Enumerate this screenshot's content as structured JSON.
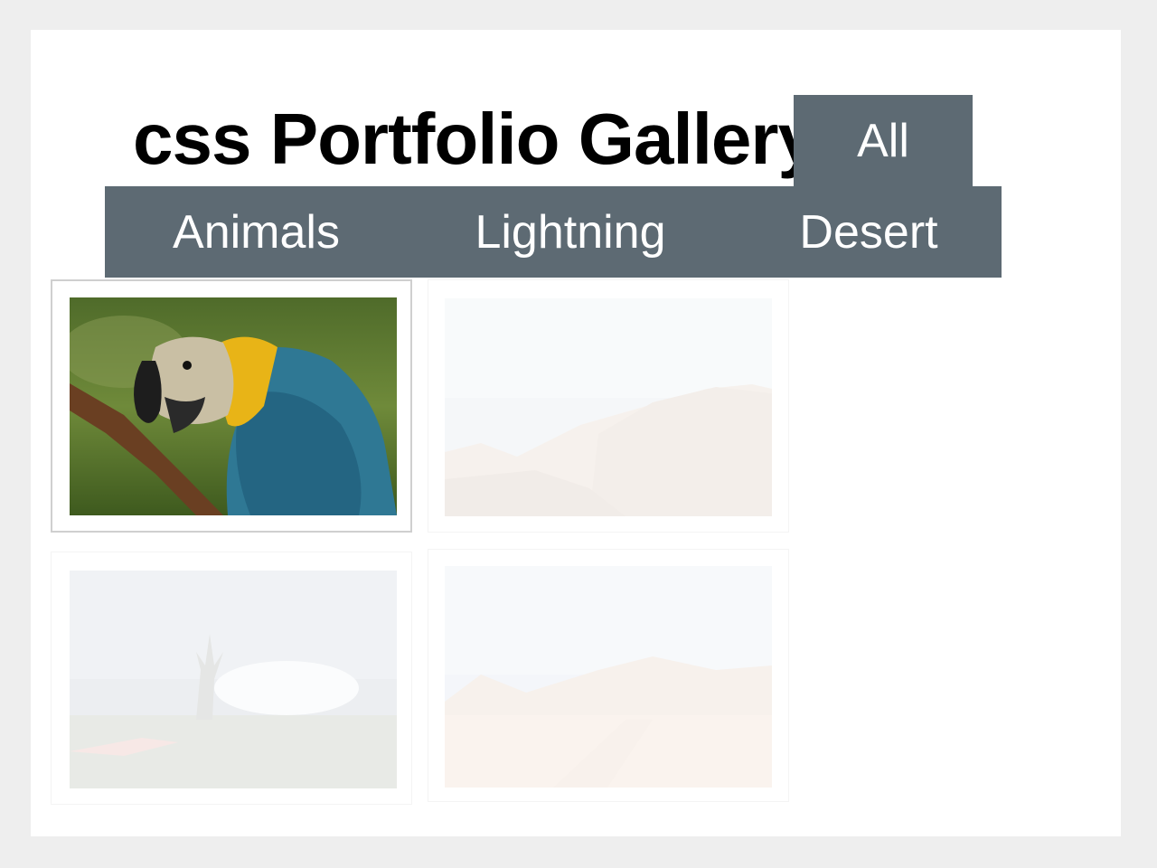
{
  "page": {
    "title": "css Portfolio Gallery"
  },
  "filters": {
    "all_label": "All",
    "animals_label": "Animals",
    "lightning_label": "Lightning",
    "desert_label": "Desert",
    "button_color": "#5d6a73"
  },
  "gallery": {
    "items": [
      {
        "subject": "parrot-photo",
        "category": "animals",
        "state": "highlighted"
      },
      {
        "subject": "desert-rock-photo",
        "category": "desert",
        "state": "faded"
      },
      {
        "subject": "lightning-tree-photo",
        "category": "lightning",
        "state": "faded"
      },
      {
        "subject": "desert-plain-photo",
        "category": "desert",
        "state": "faded"
      }
    ]
  }
}
